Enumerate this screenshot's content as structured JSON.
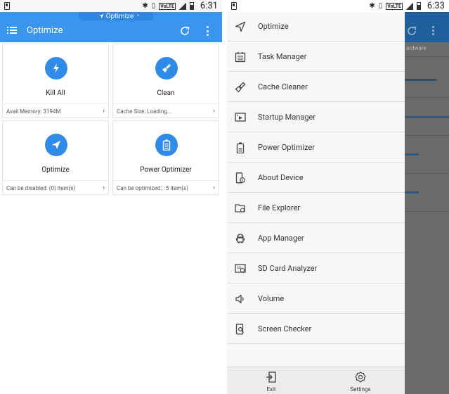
{
  "left": {
    "status": {
      "time": "6:31",
      "volte": "VoLTE",
      "network": "4G"
    },
    "toast": {
      "label": "Optimize"
    },
    "appbar": {
      "title": "Optimize"
    },
    "cards": [
      {
        "label": "Kill All",
        "footer": "Avail Memory:  3194M",
        "icon": "lightning-icon"
      },
      {
        "label": "Clean",
        "footer": "Cache Size:   Loading...",
        "icon": "broom-icon"
      },
      {
        "label": "Optimize",
        "footer": "Can be disabled:  (0) item(s)",
        "icon": "send-icon"
      },
      {
        "label": "Power Optimizer",
        "footer": "Can be optimized：5 item(s)",
        "icon": "battery-icon"
      }
    ],
    "chevron": "›"
  },
  "right": {
    "status": {
      "time": "6:33",
      "volte": "VoLTE",
      "network": "4G"
    },
    "background_text": "ardware",
    "menu": [
      {
        "label": "Optimize",
        "icon": "send-icon"
      },
      {
        "label": "Task Manager",
        "icon": "clipboard-icon"
      },
      {
        "label": "Cache Cleaner",
        "icon": "broom-icon"
      },
      {
        "label": "Startup Manager",
        "icon": "startup-icon"
      },
      {
        "label": "Power Optimizer",
        "icon": "battery-icon"
      },
      {
        "label": "About Device",
        "icon": "device-info-icon"
      },
      {
        "label": "File Explorer",
        "icon": "folder-icon"
      },
      {
        "label": "App Manager",
        "icon": "android-icon"
      },
      {
        "label": "SD Card Analyzer",
        "icon": "sd-card-icon"
      },
      {
        "label": "Volume",
        "icon": "speaker-icon"
      },
      {
        "label": "Screen Checker",
        "icon": "screen-search-icon"
      }
    ],
    "footer": [
      {
        "label": "Exit",
        "icon": "exit-icon"
      },
      {
        "label": "Settings",
        "icon": "gear-icon"
      }
    ]
  },
  "colors": {
    "accent": "#3a95ef",
    "icon_blue": "#2f8be8"
  }
}
